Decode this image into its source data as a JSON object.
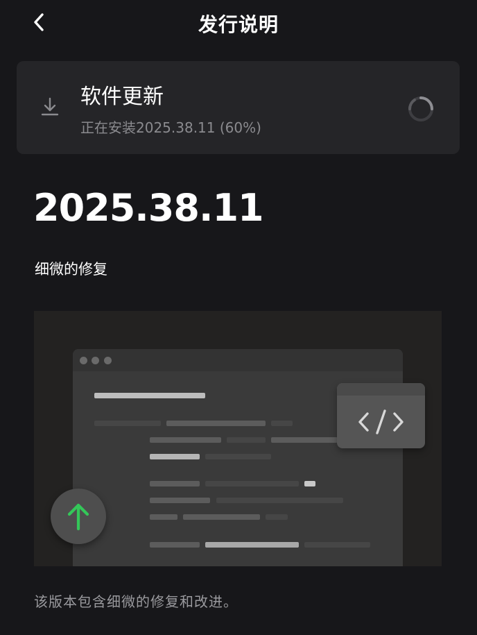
{
  "header": {
    "title": "发行说明",
    "back_icon": "chevron-left-icon"
  },
  "update_card": {
    "icon": "download-icon",
    "title": "软件更新",
    "status": "正在安装2025.38.11 (60%)",
    "spinner_icon": "loading-spinner-icon",
    "progress_percent": 60
  },
  "release": {
    "version": "2025.38.11",
    "subtitle": "细微的修复",
    "illustration": {
      "icons": [
        "browser-window-icon",
        "code-icon",
        "arrow-up-icon"
      ],
      "accent_color": "#34c759"
    },
    "description": "该版本包含细微的修复和改进。"
  },
  "colors": {
    "background": "#17171a",
    "card": "#252528",
    "text_primary": "#ffffff",
    "text_secondary": "#8b8b8f"
  }
}
